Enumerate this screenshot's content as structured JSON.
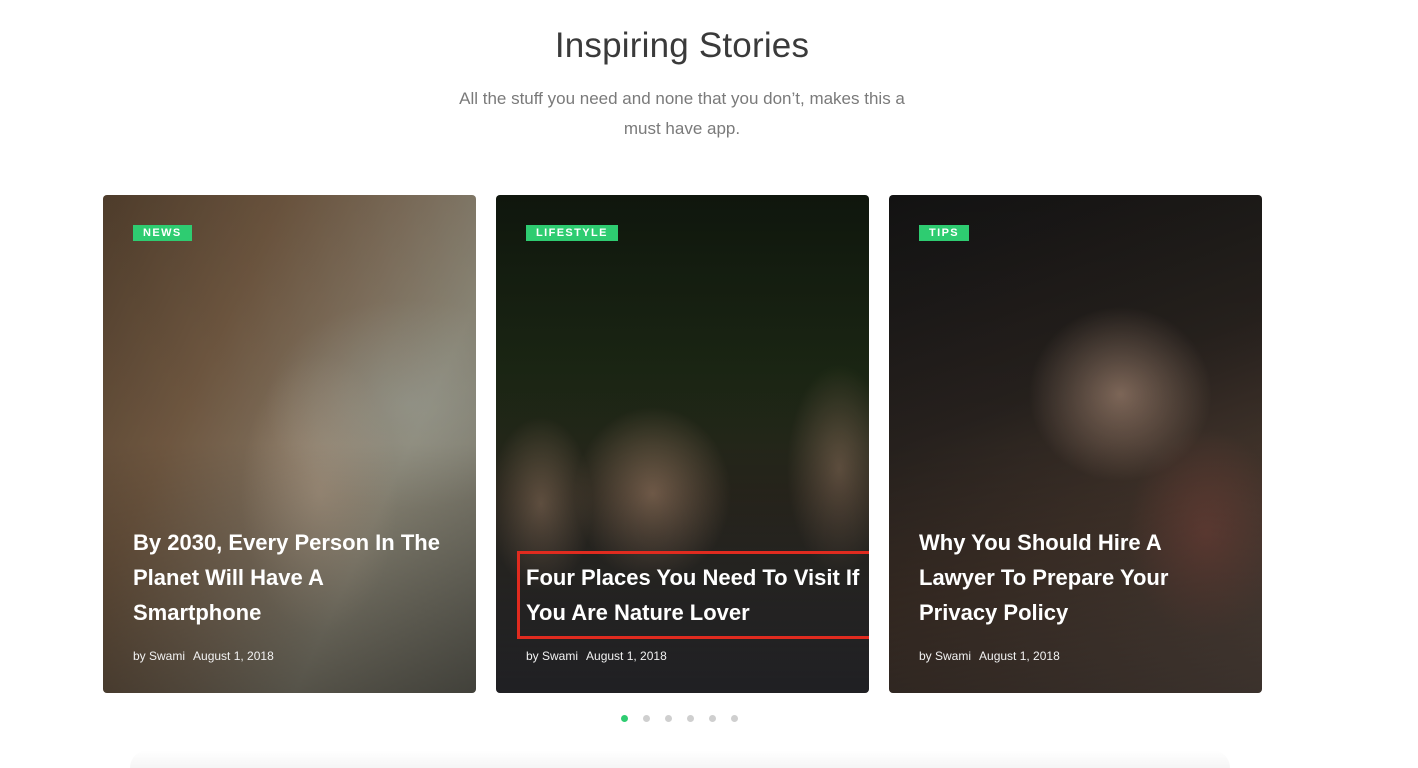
{
  "section": {
    "title": "Inspiring Stories",
    "subtitle": "All the stuff you need and none that you don’t, makes this a must have app."
  },
  "cards": [
    {
      "tag": "NEWS",
      "title": "By 2030, Every Person In The Planet Will Have A Smartphone",
      "author": "by Swami",
      "date": "August 1, 2018"
    },
    {
      "tag": "LIFESTYLE",
      "title": "Four Places You Need To Visit If You Are Nature Lover",
      "author": "by Swami",
      "date": "August 1, 2018"
    },
    {
      "tag": "TIPS",
      "title": "Why You Should Hire A Lawyer To Prepare Your Privacy Policy",
      "author": "by Swami",
      "date": "August 1, 2018"
    }
  ],
  "carousel": {
    "total_slides": 6,
    "active_slide": 1
  },
  "colors": {
    "accent": "#2ecc71",
    "highlight_box": "#e02b1f"
  }
}
